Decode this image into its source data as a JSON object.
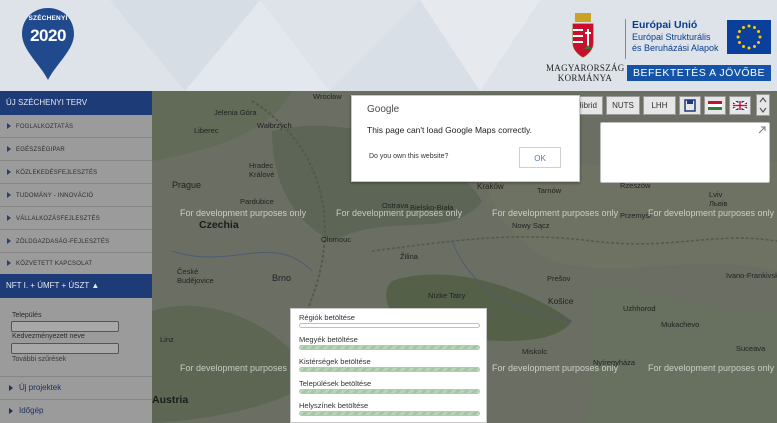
{
  "header": {
    "logo_top": "SZÉCHENYI",
    "logo_year": "2020",
    "gov_line1": "MAGYARORSZÁG",
    "gov_line2": "KORMÁNYA",
    "eu_line1": "Európai Unió",
    "eu_line2": "Európai Strukturális",
    "eu_line3": "és Beruházási Alapok",
    "banner": "BEFEKTETÉS A JÖVŐBE"
  },
  "sidebar": {
    "title": "ÚJ SZÉCHENYI TERV",
    "items": [
      {
        "label": "FOGLALKOZTATÁS"
      },
      {
        "label": "EGÉSZSÉGIPAR"
      },
      {
        "label": "KÖZLEKEDÉSFEJLESZTÉS"
      },
      {
        "label": "TUDOMÁNY - INNOVÁCIÓ"
      },
      {
        "label": "VÁLLALKOZÁSFEJLESZTÉS"
      },
      {
        "label": "ZÖLDGAZDASÁG-FEJLESZTÉS"
      },
      {
        "label": "KÖZVETETT KAPCSOLAT"
      }
    ],
    "nft_label": "NFT I. + ÚMFT + ÚSZT ▲",
    "filter": {
      "settlement_label": "Település",
      "settlement_value": "",
      "beneficiary_label": "Kedvezményezett neve",
      "beneficiary_value": "",
      "more_filters": "További szűrések"
    },
    "sub_items": [
      {
        "label": "Új projektek"
      },
      {
        "label": "Időgép"
      }
    ]
  },
  "map_controls": {
    "hybrid": "Hibrid",
    "nuts": "NUTS",
    "lhh": "LHH"
  },
  "dialog": {
    "brand": "Google",
    "message": "This page can't load Google Maps correctly.",
    "own_question": "Do you own this website?",
    "ok_label": "OK"
  },
  "map": {
    "dev_watermark": "For development purposes only",
    "places": [
      {
        "name": "Wrocław"
      },
      {
        "name": "Jelenia Góra"
      },
      {
        "name": "Wałbrzych"
      },
      {
        "name": "Liberec"
      },
      {
        "name": "Hradec Králové"
      },
      {
        "name": "Prague"
      },
      {
        "name": "Pardubice"
      },
      {
        "name": "Czechia"
      },
      {
        "name": "Olomouc"
      },
      {
        "name": "Ostrava"
      },
      {
        "name": "Bielsko-Biała"
      },
      {
        "name": "Kraków"
      },
      {
        "name": "Tarnów"
      },
      {
        "name": "Rzeszów"
      },
      {
        "name": "Nowy Sącz"
      },
      {
        "name": "Przemyśl"
      },
      {
        "name": "Lviv"
      },
      {
        "name": "Львів"
      },
      {
        "name": "České Budějovice"
      },
      {
        "name": "Brno"
      },
      {
        "name": "Žilina"
      },
      {
        "name": "Prešov"
      },
      {
        "name": "Nízke Tatry"
      },
      {
        "name": "Košice"
      },
      {
        "name": "Ivano-Frankivsk"
      },
      {
        "name": "Uzhhorod"
      },
      {
        "name": "Mukachevo"
      },
      {
        "name": "Austria"
      },
      {
        "name": "Linz"
      },
      {
        "name": "Miskolc"
      },
      {
        "name": "Nyíregyháza"
      },
      {
        "name": "Suceava"
      }
    ]
  },
  "loading": {
    "items": [
      {
        "label": "Régiók betöltése",
        "progress": 0
      },
      {
        "label": "Megyék betöltése",
        "progress": 1
      },
      {
        "label": "Kistérségek betöltése",
        "progress": 1
      },
      {
        "label": "Települések betöltése",
        "progress": 1
      },
      {
        "label": "Helyszínek betöltése",
        "progress": 1
      }
    ]
  },
  "colors": {
    "nav_dark": "#1d3b77",
    "eu_blue": "#1453a7",
    "dialog_button": "#4a78c4"
  }
}
